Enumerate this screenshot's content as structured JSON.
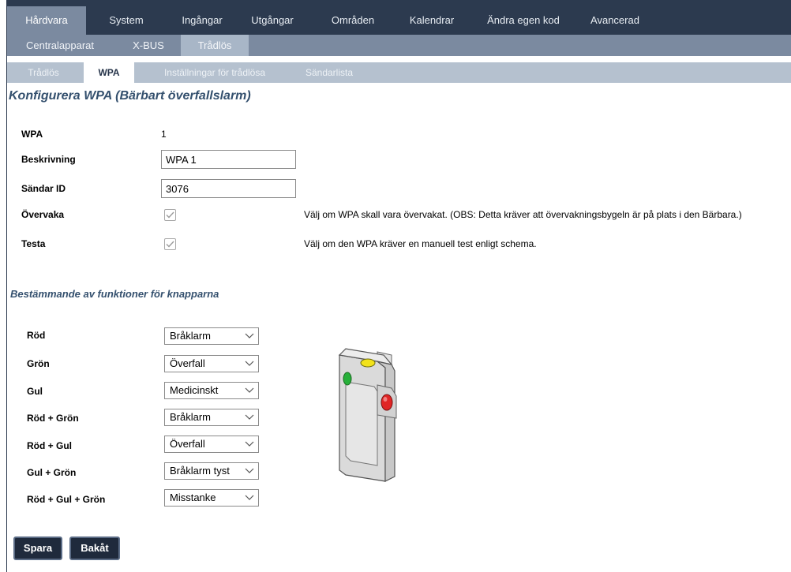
{
  "nav": {
    "level1": [
      "Hårdvara",
      "System",
      "Ingångar",
      "Utgångar",
      "Områden",
      "Kalendrar",
      "Ändra egen kod",
      "Avancerad"
    ],
    "level2": [
      "Centralapparat",
      "X-BUS",
      "Trådlös"
    ],
    "level3": [
      "Trådlös",
      "WPA",
      "Inställningar för trådlösa",
      "Sändarlista"
    ]
  },
  "page_title": "Konfigurera WPA (Bärbart överfallslarm)",
  "form": {
    "wpa_label": "WPA",
    "wpa_value": "1",
    "desc_label": "Beskrivning",
    "desc_value": "WPA 1",
    "sender_label": "Sändar ID",
    "sender_value": "3076",
    "supervise_label": "Övervaka",
    "supervise_hint": "Välj om WPA skall vara övervakat. (OBS: Detta kräver att övervakningsbygeln är på plats i den Bärbara.)",
    "supervise_checked": true,
    "test_label": "Testa",
    "test_hint": "Välj om den WPA kräver en manuell test enligt schema.",
    "test_checked": true
  },
  "buttons_section_title": "Bestämmande av funktioner för knapparna",
  "button_functions": [
    {
      "label": "Röd",
      "value": "Bråklarm"
    },
    {
      "label": "Grön",
      "value": "Överfall"
    },
    {
      "label": "Gul",
      "value": "Medicinskt"
    },
    {
      "label": "Röd + Grön",
      "value": "Bråklarm"
    },
    {
      "label": "Röd + Gul",
      "value": "Överfall"
    },
    {
      "label": "Gul + Grön",
      "value": "Bråklarm tyst"
    },
    {
      "label": "Röd + Gul + Grön",
      "value": "Misstanke"
    }
  ],
  "actions": {
    "save": "Spara",
    "back": "Bakåt"
  },
  "colors": {
    "nav_dark": "#2c3a4f",
    "nav_mid": "#7b8aa0",
    "nav_light": "#b5c1cf",
    "title": "#34506e",
    "button": "#1f2a3c"
  }
}
